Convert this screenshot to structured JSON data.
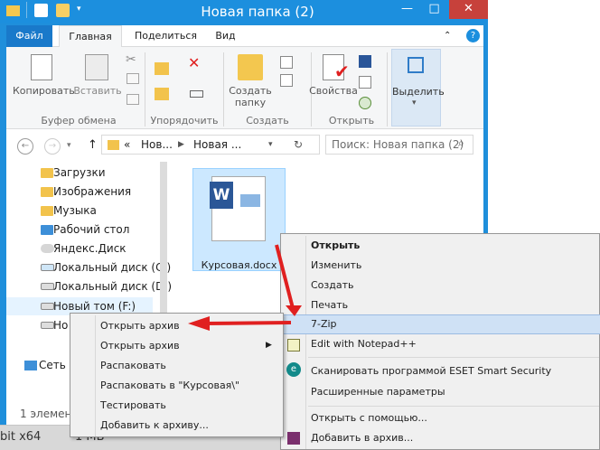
{
  "window": {
    "title": "Новая папка (2)"
  },
  "ribbon": {
    "tabs": {
      "file": "Файл",
      "home": "Главная",
      "share": "Поделиться",
      "view": "Вид"
    },
    "buttons": {
      "copy": "Копировать",
      "paste": "Вставить",
      "new_folder_line1": "Создать",
      "new_folder_line2": "папку",
      "properties": "Свойства",
      "select": "Выделить"
    },
    "groups": {
      "clipboard": "Буфер обмена",
      "organize": "Упорядочить",
      "create": "Создать",
      "open": "Открыть"
    }
  },
  "navigation": {
    "address_parts": {
      "lead": "«",
      "first": "Нов...",
      "second": "Новая ..."
    },
    "search_placeholder": "Поиск: Новая папка (2)"
  },
  "sidebar": {
    "items": [
      "Загрузки",
      "Изображения",
      "Музыка",
      "Рабочий стол",
      "Яндекс.Диск",
      "Локальный диск (C:)",
      "Локальный диск (D:)",
      "Новый том (F:)",
      "Но",
      "Сеть"
    ]
  },
  "file": {
    "name": "Курсовая.docx"
  },
  "status": {
    "items_count": "1 элемент"
  },
  "taskbar": {
    "bits": "bit x64",
    "size": "1 МБ"
  },
  "context_menu": {
    "open": "Открыть",
    "edit": "Изменить",
    "create": "Создать",
    "print": "Печать",
    "sevenzip": "7-Zip",
    "notepad": "Edit with Notepad++",
    "eset": "Сканировать программой ESET Smart Security",
    "advanced": "Расширенные параметры",
    "open_with": "Открыть с помощью...",
    "add_to_archive": "Добавить в архив..."
  },
  "zip_menu": {
    "open_archive": "Открыть архив",
    "open_archive_sub": "Открыть архив",
    "extract": "Распаковать",
    "extract_to": "Распаковать в \"Курсовая\\\"",
    "test": "Тестировать",
    "add": "Добавить к архиву..."
  },
  "colors": {
    "titlebar": "#1c8fde",
    "accent_red": "#e02020",
    "selection": "#cce8ff"
  }
}
